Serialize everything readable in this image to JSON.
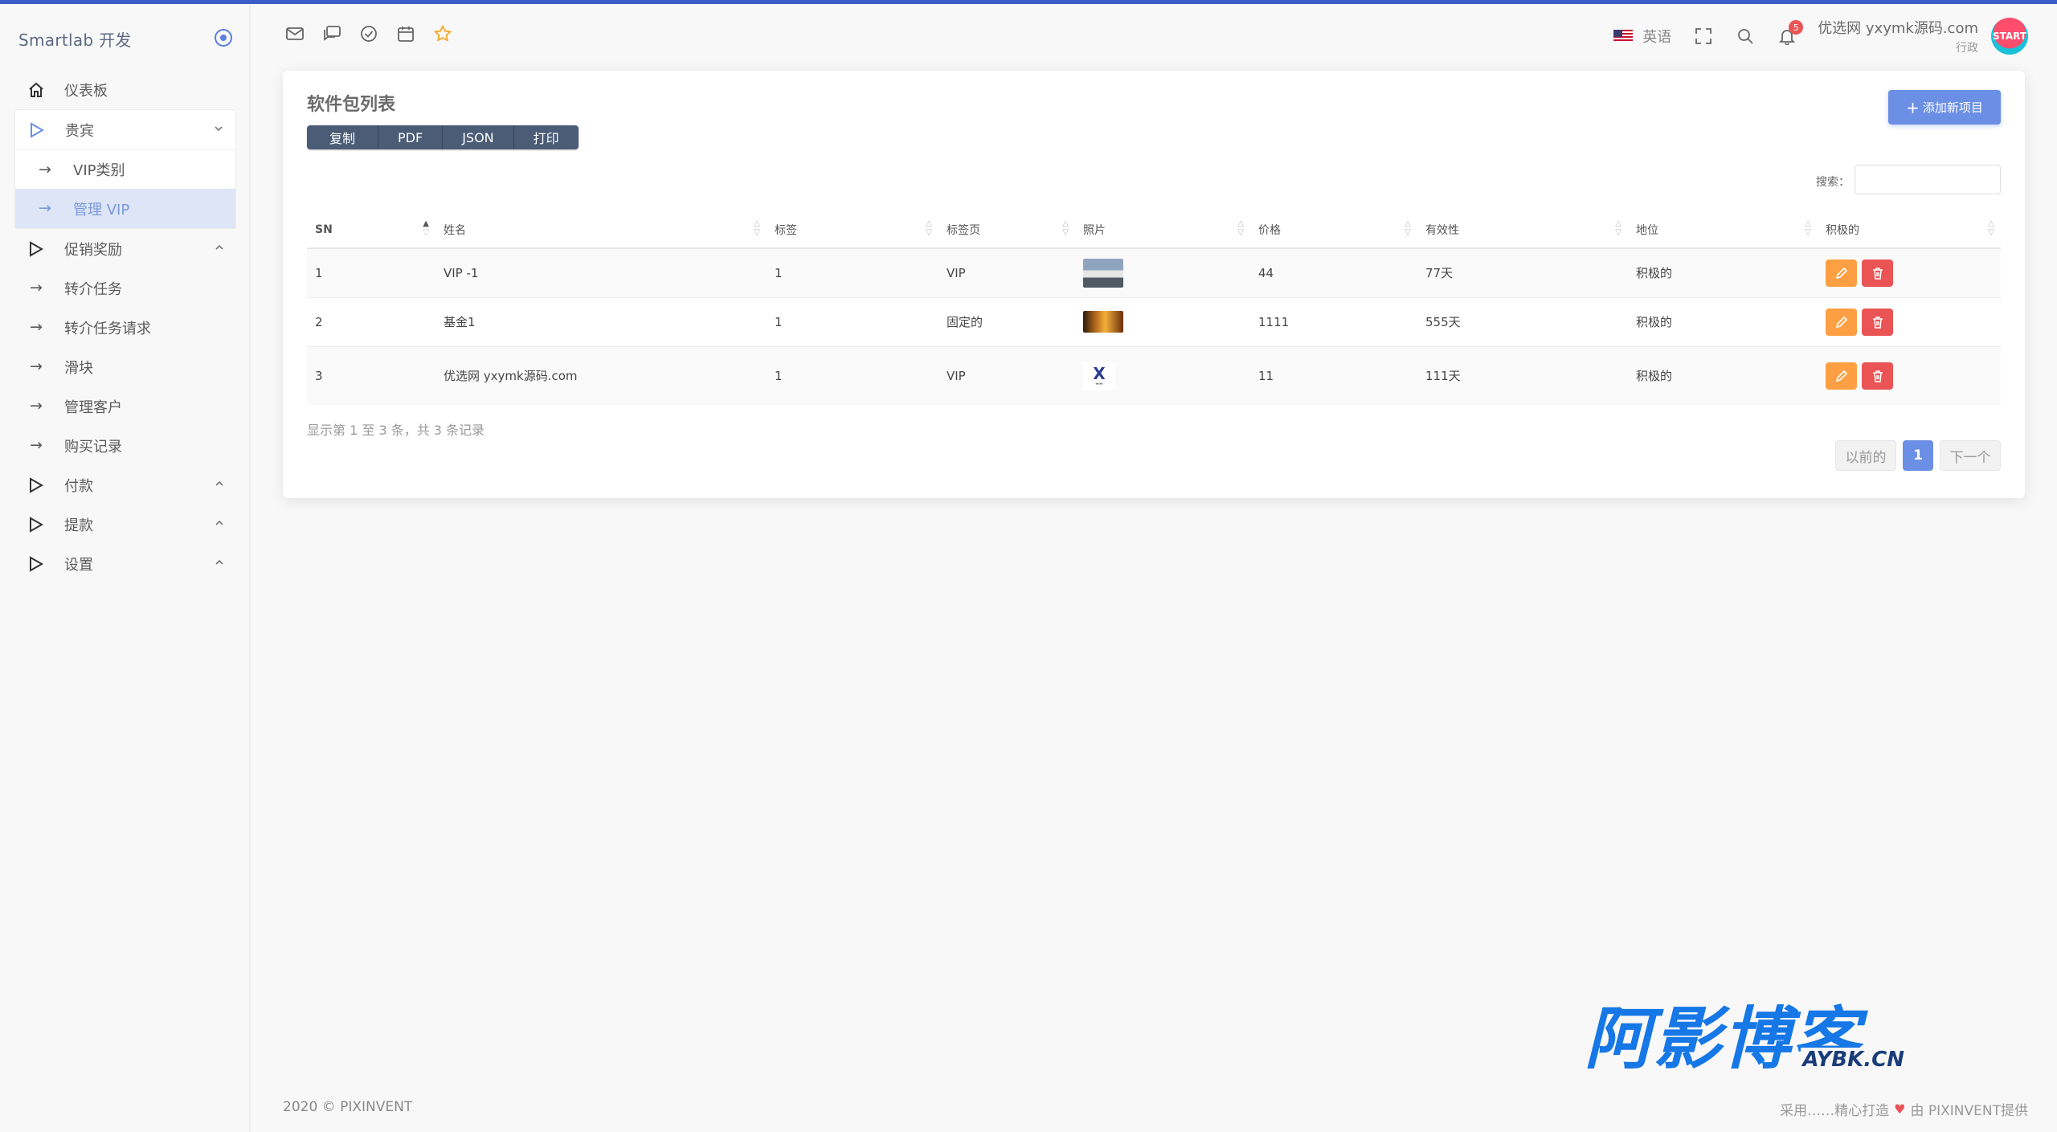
{
  "brand": {
    "name": "Smartlab 开发"
  },
  "sidebar": {
    "items": [
      {
        "label": "仪表板"
      },
      {
        "label": "贵宾"
      },
      {
        "label": "VIP类别"
      },
      {
        "label": "管理 VIP"
      },
      {
        "label": "促销奖励"
      },
      {
        "label": "转介任务"
      },
      {
        "label": "转介任务请求"
      },
      {
        "label": "滑块"
      },
      {
        "label": "管理客户"
      },
      {
        "label": "购买记录"
      },
      {
        "label": "付款"
      },
      {
        "label": "提款"
      },
      {
        "label": "设置"
      }
    ]
  },
  "topbar": {
    "language": "英语",
    "notification_count": "5",
    "user_name": "优选网 yxymk源码.com",
    "user_role": "行政",
    "avatar_text": "START"
  },
  "card": {
    "title": "软件包列表",
    "export_buttons": [
      "复制",
      "PDF",
      "JSON",
      "打印"
    ],
    "add_button": "添加新项目",
    "search_label": "搜索：",
    "columns": [
      "SN",
      "姓名",
      "标签",
      "标签页",
      "照片",
      "价格",
      "有效性",
      "地位",
      "积极的"
    ],
    "rows": [
      {
        "sn": "1",
        "name": "VIP -1",
        "tag": "1",
        "tab": "VIP",
        "price": "44",
        "validity": "77天",
        "status": "积极的"
      },
      {
        "sn": "2",
        "name": "基金1",
        "tag": "1",
        "tab": "固定的",
        "price": "1111",
        "validity": "555天",
        "status": "积极的"
      },
      {
        "sn": "3",
        "name": "优选网 yxymk源码.com",
        "tag": "1",
        "tab": "VIP",
        "price": "11",
        "validity": "111天",
        "status": "积极的"
      }
    ],
    "info": "显示第 1 至 3 条，共 3 条记录",
    "pager": {
      "prev": "以前的",
      "current": "1",
      "next": "下一个"
    }
  },
  "watermark": {
    "cn": "阿影博客",
    "en": "AYBK.CN"
  },
  "footer": {
    "left": "2020 © PIXINVENT",
    "right_prefix": "采用……精心打造",
    "right_suffix": "由 PIXINVENT提供"
  },
  "colors": {
    "primary": "#6b8fe5",
    "edit": "#ff9f43",
    "delete": "#ea5455",
    "export": "#4b5c77"
  }
}
